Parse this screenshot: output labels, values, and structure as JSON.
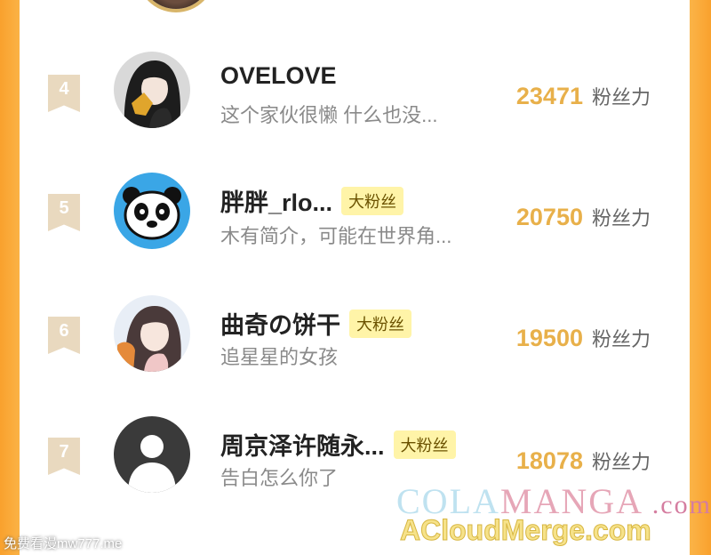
{
  "fans": [
    {
      "rank": "4",
      "name": "OVELOVE",
      "badge": "",
      "bio": "这个家伙很懒 什么也没...",
      "score": "23471",
      "unit": "粉丝力",
      "avatar": "dark-hair-girl-avatar"
    },
    {
      "rank": "5",
      "name": "胖胖_rlo...",
      "badge": "大粉丝",
      "bio": "木有简介，可能在世界角...",
      "score": "20750",
      "unit": "粉丝力",
      "avatar": "panda-avatar"
    },
    {
      "rank": "6",
      "name": "曲奇の饼干",
      "badge": "大粉丝",
      "bio": "追星星的女孩",
      "score": "19500",
      "unit": "粉丝力",
      "avatar": "anime-girl-avatar"
    },
    {
      "rank": "7",
      "name": "周京泽许随永...",
      "badge": "大粉丝",
      "bio": "告白怎么你了",
      "score": "18078",
      "unit": "粉丝力",
      "avatar": "default-person-avatar"
    }
  ],
  "watermark": {
    "cola_a": "COLA",
    "cola_b": "MANGA",
    "cola_c": ".com",
    "acloud": "ACloudMerge.com",
    "left": "免费看漫mw777.me"
  },
  "colors": {
    "score": "#e8b04a",
    "badge_bg": "#fff4a8",
    "rank_bg": "#e9d9bf",
    "frame": "#fbb94f"
  }
}
